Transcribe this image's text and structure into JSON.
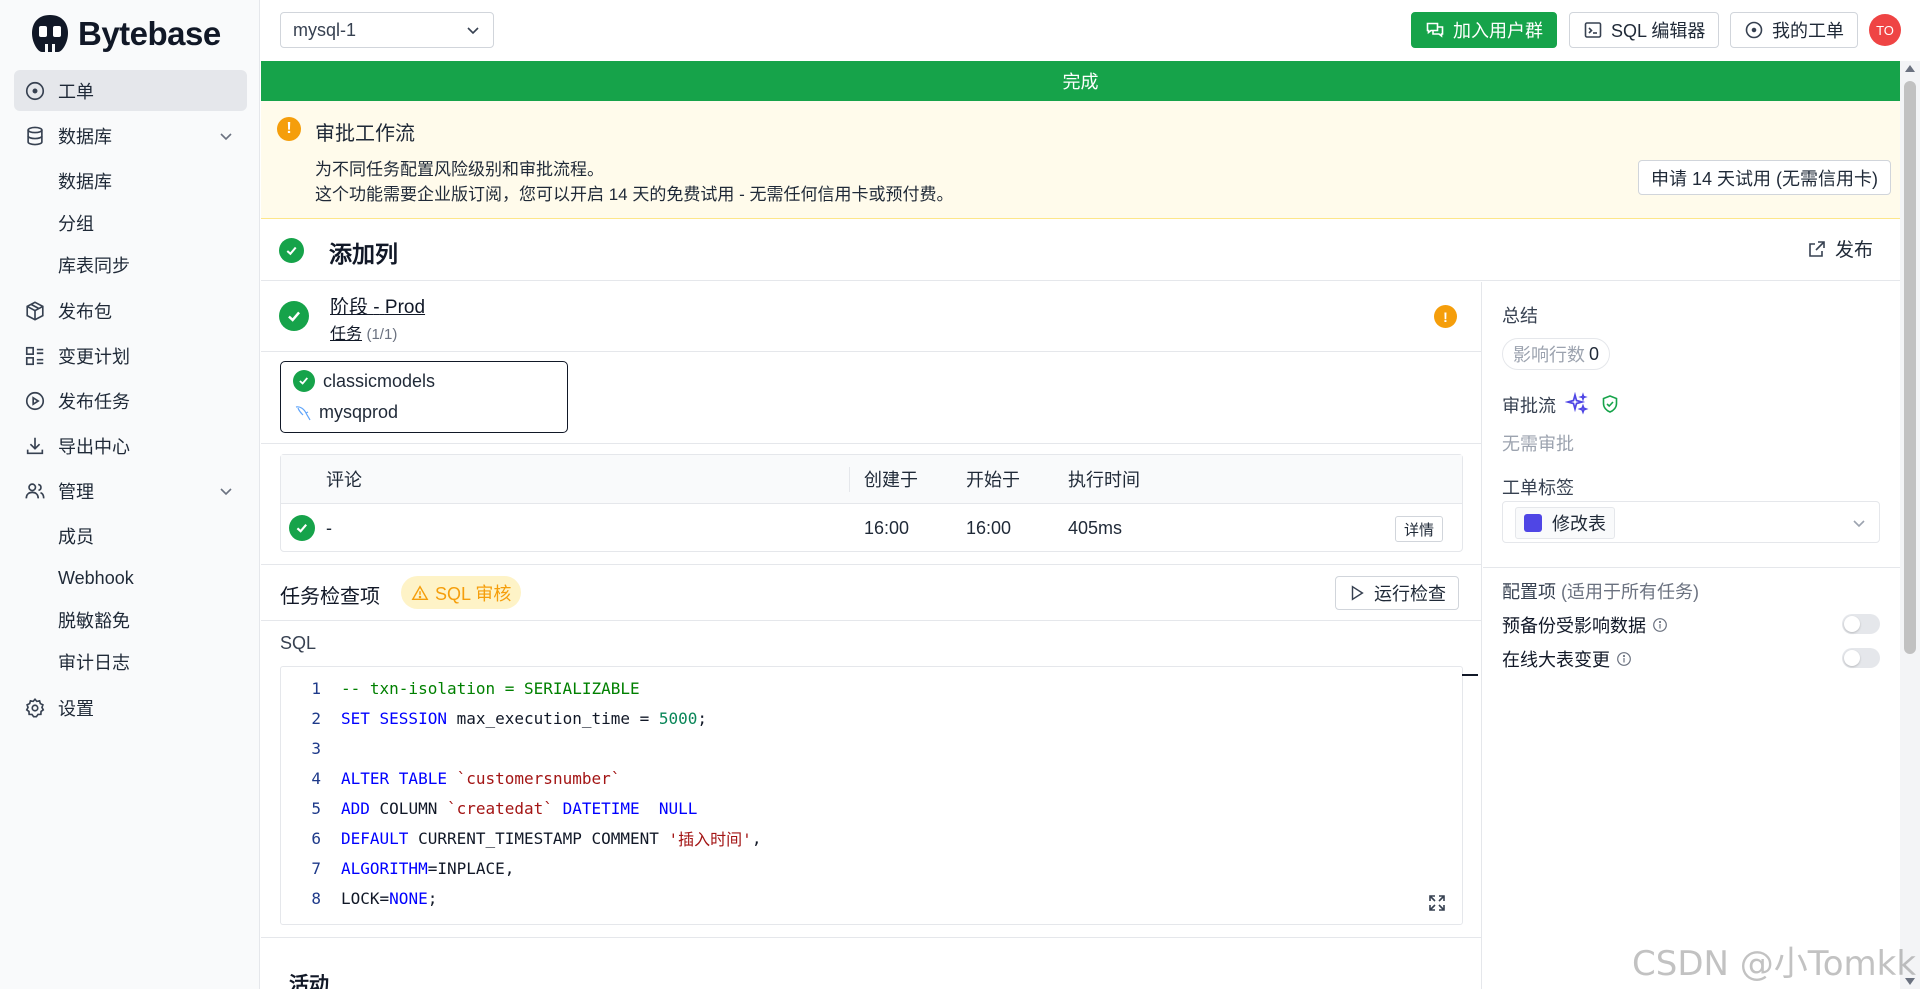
{
  "app": {
    "name": "Bytebase"
  },
  "sidebar": {
    "items": [
      {
        "label": "工单",
        "icon": "circle-dot-icon",
        "active": true
      },
      {
        "label": "数据库",
        "icon": "database-icon",
        "expandable": true,
        "children": [
          "数据库",
          "分组",
          "库表同步"
        ]
      },
      {
        "label": "发布包",
        "icon": "package-icon"
      },
      {
        "label": "变更计划",
        "icon": "list-grid-icon"
      },
      {
        "label": "发布任务",
        "icon": "play-circle-icon"
      },
      {
        "label": "导出中心",
        "icon": "download-icon"
      },
      {
        "label": "管理",
        "icon": "users-icon",
        "expandable": true,
        "children": [
          "成员",
          "Webhook",
          "脱敏豁免",
          "审计日志"
        ]
      },
      {
        "label": "设置",
        "icon": "gear-icon"
      }
    ]
  },
  "topbar": {
    "instance": "mysql-1",
    "join_group": "加入用户群",
    "sql_editor": "SQL 编辑器",
    "my_issues": "我的工单",
    "avatar": "TO",
    "colors": {
      "primary": "#16a34a",
      "avatar": "#ef4444"
    }
  },
  "status_bar": {
    "text": "完成"
  },
  "approval_notice": {
    "title": "审批工作流",
    "line1": "为不同任务配置风险级别和审批流程。",
    "line2": "这个功能需要企业版订阅，您可以开启 14 天的免费试用 - 无需任何信用卡或预付费。",
    "trial_button": "申请 14 天试用 (无需信用卡)"
  },
  "issue": {
    "title": "添加列",
    "publish": "发布"
  },
  "stage": {
    "name": "阶段",
    "dash": "-",
    "env": "Prod",
    "task_label": "任务",
    "task_count": "(1/1)"
  },
  "task_card": {
    "database": "classicmodels",
    "instance": "mysqprod"
  },
  "task_runs": {
    "headers": {
      "comment": "评论",
      "created": "创建于",
      "started": "开始于",
      "duration": "执行时间"
    },
    "row": {
      "comment": "-",
      "created": "16:00",
      "started": "16:00",
      "duration": "405ms",
      "detail": "详情"
    }
  },
  "checks": {
    "title": "任务检查项",
    "sql_review": "SQL 审核",
    "run": "运行检查"
  },
  "sql": {
    "label": "SQL",
    "lines": [
      {
        "n": "1",
        "parts": [
          {
            "t": "-- txn-isolation = SERIALIZABLE",
            "c": "cm"
          }
        ]
      },
      {
        "n": "2",
        "parts": [
          {
            "t": "SET SESSION",
            "c": "kw"
          },
          {
            "t": " max_execution_time = ",
            "c": "plain"
          },
          {
            "t": "5000",
            "c": "num"
          },
          {
            "t": ";",
            "c": "plain"
          }
        ]
      },
      {
        "n": "3",
        "parts": []
      },
      {
        "n": "4",
        "parts": [
          {
            "t": "ALTER TABLE",
            "c": "kw"
          },
          {
            "t": " ",
            "c": "plain"
          },
          {
            "t": "`customersnumber`",
            "c": "str"
          }
        ]
      },
      {
        "n": "5",
        "parts": [
          {
            "t": "ADD",
            "c": "kw"
          },
          {
            "t": " COLUMN ",
            "c": "plain"
          },
          {
            "t": "`createdat`",
            "c": "str"
          },
          {
            "t": " ",
            "c": "plain"
          },
          {
            "t": "DATETIME  NULL",
            "c": "kw"
          }
        ]
      },
      {
        "n": "6",
        "parts": [
          {
            "t": "DEFAULT",
            "c": "kw"
          },
          {
            "t": " CURRENT_TIMESTAMP COMMENT ",
            "c": "plain"
          },
          {
            "t": "'插入时间'",
            "c": "str"
          },
          {
            "t": ",",
            "c": "plain"
          }
        ]
      },
      {
        "n": "7",
        "parts": [
          {
            "t": "ALGORITHM",
            "c": "kw"
          },
          {
            "t": "=INPLACE,",
            "c": "plain"
          }
        ]
      },
      {
        "n": "8",
        "parts": [
          {
            "t": "LOCK=",
            "c": "plain"
          },
          {
            "t": "NONE",
            "c": "kw"
          },
          {
            "t": ";",
            "c": "plain"
          }
        ]
      }
    ]
  },
  "activity": {
    "title": "活动"
  },
  "right_panel": {
    "summary_title": "总结",
    "affected_rows_label": "影响行数",
    "affected_rows_value": "0",
    "approval_flow_label": "审批流",
    "no_approval": "无需审批",
    "issue_labels_title": "工单标签",
    "label_chip": "修改表",
    "config_title": "配置项",
    "config_scope": "(适用于所有任务)",
    "backup_option": "预备份受影响数据",
    "online_option": "在线大表变更"
  },
  "watermark": "CSDN @小Tomkk"
}
